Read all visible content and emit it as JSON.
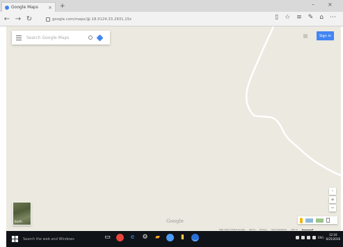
{
  "browser": {
    "tab_title": "Google Maps",
    "tab_close": "×",
    "new_tab": "+",
    "minimize": "–",
    "close": "×",
    "url": "google.com/maps/@-18.0124,33.2931,15z"
  },
  "map": {
    "search_placeholder": "Search Google Maps",
    "sign_in_label": "Sign in",
    "earth_label": "Earth",
    "google_logo": "Google",
    "zoom_in": "+",
    "zoom_out": "−",
    "footer": {
      "map_data": "Map data ©2016 Google",
      "terms": "Terms",
      "privacy": "Privacy",
      "feedback": "Send feedback",
      "scale": "200 m"
    }
  },
  "taskbar": {
    "search_text": "Search the web and Windows",
    "language": "ENG",
    "time": "12:16",
    "date": "6/25/2016"
  },
  "colors": {
    "map_bg": "#ece9e0",
    "road": "#ffffff",
    "accent": "#4285f4",
    "taskbar": "#101318"
  }
}
